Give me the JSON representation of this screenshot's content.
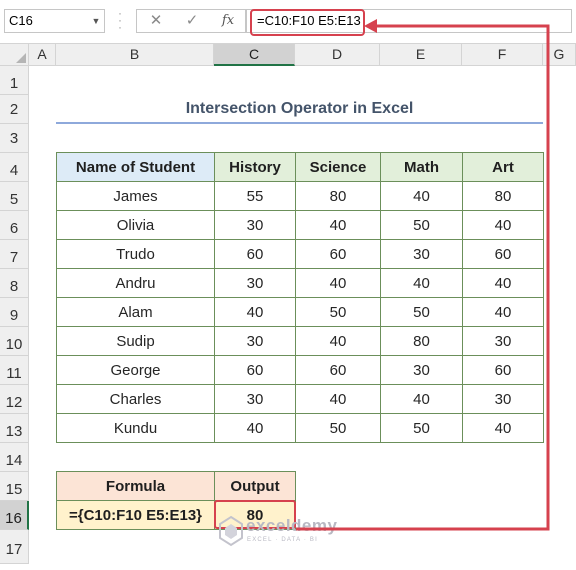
{
  "formula_bar": {
    "name_box": "C16",
    "cancel_icon": "x-icon",
    "enter_icon": "check-icon",
    "function_label": "fx",
    "formula": "=C10:F10 E5:E13"
  },
  "columns": [
    "A",
    "B",
    "C",
    "D",
    "E",
    "F",
    "G"
  ],
  "rows": [
    "1",
    "2",
    "3",
    "4",
    "5",
    "6",
    "7",
    "8",
    "9",
    "10",
    "11",
    "12",
    "13",
    "14",
    "15",
    "16",
    "17"
  ],
  "selected_cell": "C16",
  "sheet": {
    "title": "Intersection Operator in Excel",
    "table": {
      "headers": [
        "Name of Student",
        "History",
        "Science",
        "Math",
        "Art"
      ],
      "rows": [
        [
          "James",
          "55",
          "80",
          "40",
          "80"
        ],
        [
          "Olivia",
          "30",
          "40",
          "50",
          "40"
        ],
        [
          "Trudo",
          "60",
          "60",
          "30",
          "60"
        ],
        [
          "Andru",
          "30",
          "40",
          "40",
          "40"
        ],
        [
          "Alam",
          "40",
          "50",
          "50",
          "40"
        ],
        [
          "Sudip",
          "30",
          "40",
          "80",
          "30"
        ],
        [
          "George",
          "60",
          "60",
          "30",
          "60"
        ],
        [
          "Charles",
          "30",
          "40",
          "40",
          "30"
        ],
        [
          "Kundu",
          "40",
          "50",
          "50",
          "40"
        ]
      ]
    },
    "output": {
      "formula_header": "Formula",
      "output_header": "Output",
      "formula_text": "={C10:F10 E5:E13}",
      "output_value": "80"
    }
  },
  "watermark": {
    "name": "exceldemy",
    "tagline": "EXCEL · DATA · BI"
  },
  "colors": {
    "annotation": "#d6414e",
    "table_border": "#6b8f5a",
    "header_fill": "#e2efda",
    "name_header_fill": "#ddebf7",
    "formula_header_fill": "#fce4d6",
    "formula_cell_fill": "#fff2cc",
    "title_text": "#44546a"
  }
}
